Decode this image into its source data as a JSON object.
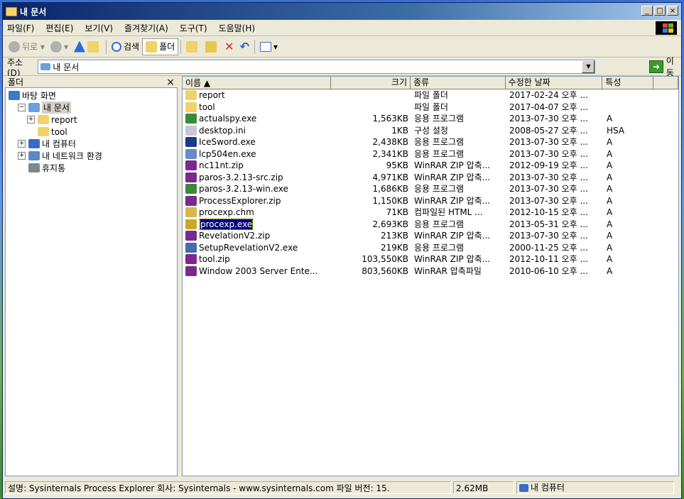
{
  "window": {
    "title": "내 문서"
  },
  "menu": [
    "파일(F)",
    "편집(E)",
    "보기(V)",
    "즐겨찾기(A)",
    "도구(T)",
    "도움말(H)"
  ],
  "toolbar": {
    "back": "뒤로",
    "search": "검색",
    "folders": "폴더"
  },
  "address": {
    "label": "주소(D)",
    "value": "내 문서",
    "go": "이동"
  },
  "folder_pane": {
    "title": "폴더",
    "close": "×",
    "tree": [
      {
        "label": "바탕 화면",
        "level": 0,
        "expander": "",
        "icon": "desktop-icon"
      },
      {
        "label": "내 문서",
        "level": 1,
        "expander": "⊟",
        "icon": "mydocs-icon",
        "selected": true
      },
      {
        "label": "report",
        "level": 2,
        "expander": "⊞",
        "icon": "folder-icon"
      },
      {
        "label": "tool",
        "level": 2,
        "expander": "",
        "icon": "folder-icon"
      },
      {
        "label": "내 컴퓨터",
        "level": 1,
        "expander": "⊞",
        "icon": "computer-icon"
      },
      {
        "label": "내 네트워크 환경",
        "level": 1,
        "expander": "⊞",
        "icon": "network-icon"
      },
      {
        "label": "휴지통",
        "level": 1,
        "expander": "",
        "icon": "recycle-bin-icon"
      }
    ]
  },
  "columns": {
    "name": "이름 ▲",
    "size": "크기",
    "type": "종류",
    "date": "수정한 날짜",
    "attr": "특성"
  },
  "files": [
    {
      "name": "report",
      "size": "",
      "type": "파일 폴더",
      "date": "2017-02-24 오후 ...",
      "attr": "",
      "icon": "folder-icon",
      "color": "#f1d16a"
    },
    {
      "name": "tool",
      "size": "",
      "type": "파일 폴더",
      "date": "2017-04-07 오후 ...",
      "attr": "",
      "icon": "folder-icon",
      "color": "#f1d16a"
    },
    {
      "name": "actualspy.exe",
      "size": "1,563KB",
      "type": "응용 프로그램",
      "date": "2013-07-30 오후 ...",
      "attr": "A",
      "icon": "exe-icon",
      "color": "#3a8a3a"
    },
    {
      "name": "desktop.ini",
      "size": "1KB",
      "type": "구성 설정",
      "date": "2008-05-27 오후 ...",
      "attr": "HSA",
      "icon": "ini-icon",
      "color": "#c8c8d8"
    },
    {
      "name": "IceSword.exe",
      "size": "2,438KB",
      "type": "응용 프로그램",
      "date": "2013-07-30 오후 ...",
      "attr": "A",
      "icon": "icesword-icon",
      "color": "#1a3a8a"
    },
    {
      "name": "lcp504en.exe",
      "size": "2,341KB",
      "type": "응용 프로그램",
      "date": "2013-07-30 오후 ...",
      "attr": "A",
      "icon": "installer-icon",
      "color": "#6a8ac8"
    },
    {
      "name": "nc11nt.zip",
      "size": "95KB",
      "type": "WinRAR ZIP 압축...",
      "date": "2012-09-19 오후 ...",
      "attr": "A",
      "icon": "winrar-icon",
      "color": "#7a2a8a"
    },
    {
      "name": "paros-3.2.13-src.zip",
      "size": "4,971KB",
      "type": "WinRAR ZIP 압축...",
      "date": "2013-07-30 오후 ...",
      "attr": "A",
      "icon": "winrar-icon",
      "color": "#7a2a8a"
    },
    {
      "name": "paros-3.2.13-win.exe",
      "size": "1,686KB",
      "type": "응용 프로그램",
      "date": "2013-07-30 오후 ...",
      "attr": "A",
      "icon": "exe-icon",
      "color": "#3a8a3a"
    },
    {
      "name": "ProcessExplorer.zip",
      "size": "1,150KB",
      "type": "WinRAR ZIP 압축...",
      "date": "2013-07-30 오후 ...",
      "attr": "A",
      "icon": "winrar-icon",
      "color": "#7a2a8a"
    },
    {
      "name": "procexp.chm",
      "size": "71KB",
      "type": "컴파일된 HTML ...",
      "date": "2012-10-15 오후 ...",
      "attr": "A",
      "icon": "chm-icon",
      "color": "#d8b84a"
    },
    {
      "name": "procexp.exe",
      "size": "2,693KB",
      "type": "응용 프로그램",
      "date": "2013-05-31 오후 ...",
      "attr": "A",
      "icon": "procexp-icon",
      "color": "#c8a82a",
      "selected": true
    },
    {
      "name": "RevelationV2.zip",
      "size": "213KB",
      "type": "WinRAR ZIP 압축...",
      "date": "2013-07-30 오후 ...",
      "attr": "A",
      "icon": "winrar-icon",
      "color": "#7a2a8a"
    },
    {
      "name": "SetupRevelationV2.exe",
      "size": "219KB",
      "type": "응용 프로그램",
      "date": "2000-11-25 오후 ...",
      "attr": "A",
      "icon": "setup-icon",
      "color": "#4a6aa8"
    },
    {
      "name": "tool.zip",
      "size": "103,550KB",
      "type": "WinRAR ZIP 압축...",
      "date": "2012-10-11 오후 ...",
      "attr": "A",
      "icon": "winrar-icon",
      "color": "#7a2a8a"
    },
    {
      "name": "Window 2003 Server Ente...",
      "size": "803,560KB",
      "type": "WinRAR 압축파일",
      "date": "2010-06-10 오후 ...",
      "attr": "A",
      "icon": "winrar-icon",
      "color": "#7a2a8a"
    }
  ],
  "status": {
    "description": "설명: Sysinternals Process Explorer 회사: Sysinternals - www.sysinternals.com 파일 버전: 15.",
    "size": "2.62MB",
    "location": "내 컴퓨터"
  }
}
